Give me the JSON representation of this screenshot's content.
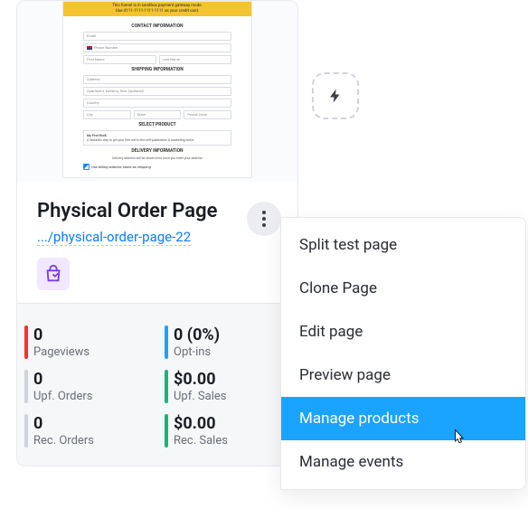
{
  "preview": {
    "banner_line1": "This funnel is in sandbox payment gateway mode.",
    "banner_line2": "Use 4111-1111-1111-1111 as your credit card.",
    "sections": {
      "contact": "CONTACT INFORMATION",
      "shipping": "SHIPPING INFORMATION",
      "product": "SELECT PRODUCT",
      "delivery": "DELIVERY INFORMATION"
    },
    "fields": {
      "email": "Email",
      "phone": "Phone Number",
      "first": "First Name",
      "last": "Last Name",
      "address": "Address",
      "apt": "Apartment, building, floor (optional)",
      "country": "Country",
      "city": "City",
      "state": "State",
      "postal": "Postal Code"
    },
    "product_box_title": "My First Book",
    "product_box_desc": "A fantastic way to get your feet wet in the self-publication & marketing world.",
    "delivery_note": "Delivery address will be shown here once you enter your address",
    "billing_same": "Use billing address same as shipping"
  },
  "page": {
    "title": "Physical Order Page",
    "url": ".../physical-order-page-22"
  },
  "stats": [
    {
      "value": "0",
      "label": "Pageviews",
      "bar": "#ff2e2e"
    },
    {
      "value": "0 (0%)",
      "label": "Opt-ins",
      "bar": "#1aa3ff"
    },
    {
      "value": "0",
      "label": "Upf. Orders",
      "bar": "#d0d3d9"
    },
    {
      "value": "$0.00",
      "label": "Upf. Sales",
      "bar": "#11b876"
    },
    {
      "value": "0",
      "label": "Rec. Orders",
      "bar": "#d0d3d9"
    },
    {
      "value": "$0.00",
      "label": "Rec. Sales",
      "bar": "#11b876"
    }
  ],
  "menu": {
    "items": [
      {
        "label": "Split test page",
        "active": false
      },
      {
        "label": "Clone Page",
        "active": false
      },
      {
        "label": "Edit page",
        "active": false
      },
      {
        "label": "Preview page",
        "active": false
      },
      {
        "label": "Manage products",
        "active": true
      },
      {
        "label": "Manage events",
        "active": false
      }
    ]
  }
}
